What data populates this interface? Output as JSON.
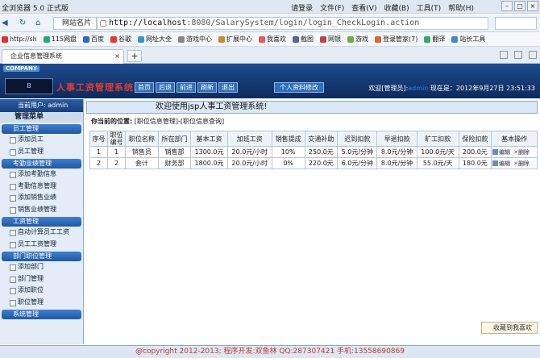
{
  "browser": {
    "title": "全浏览器 5.0 正式版",
    "menu": [
      "请登录",
      "文件(F)",
      "查看(V)",
      "收藏(B)",
      "工具(T)",
      "帮助(H)"
    ],
    "site_name": "网站名片",
    "url_host": "http://localhost",
    "url_path": ":8080/SalarySystem/login/login_CheckLogin.action",
    "favorites": [
      "http://sh",
      "115网盘",
      "百度",
      "谷歌",
      "网址大全",
      "游戏中心",
      "扩展中心",
      "我喜欢",
      "截图",
      "网银",
      "游戏",
      "登录管家(7)",
      "翻译",
      "站长工具"
    ],
    "tab_title": "企业信息管理系统",
    "new_tab": "+"
  },
  "app": {
    "company": "COMPANY",
    "logo": "B",
    "system_title": "人事工资管理系统",
    "menus": [
      "首页",
      "后退",
      "前进",
      "刷新",
      "退出"
    ],
    "profile": "个人资料修改",
    "welcome_label": "欢迎[管理员]:",
    "welcome_user": "admin",
    "now_label": "现在是：",
    "now_value": "2012年9月27日 23:51:33"
  },
  "sidebar": {
    "current_user": "当前用户: admin",
    "menu_title": "管理菜单",
    "groups": [
      {
        "label": "员工管理",
        "items": [
          "添加员工",
          "员工管理"
        ]
      },
      {
        "label": "考勤业绩管理",
        "items": [
          "添加考勤信息",
          "考勤信息管理",
          "添加销售业绩",
          "销售业绩管理"
        ]
      },
      {
        "label": "工资管理",
        "items": [
          "自动计算员工工资",
          "员工工资管理"
        ]
      },
      {
        "label": "部门职位管理",
        "items": [
          "添加部门",
          "部门管理",
          "添加职位",
          "职位管理"
        ]
      },
      {
        "label": "系统管理",
        "items": []
      }
    ]
  },
  "main": {
    "welcome": "欢迎使用jsp人事工资管理系统!",
    "location_label": "你当前的位置:",
    "location_path": "[职位信息管理]-[职位信息查询]",
    "table": {
      "headers": [
        "序号",
        "职位编号",
        "职位名称",
        "所在部门",
        "基本工资",
        "加班工资",
        "销售提成",
        "交通补助",
        "迟到扣款",
        "早退扣款",
        "旷工扣款",
        "保险扣款",
        "基本操作"
      ],
      "rows": [
        [
          "1",
          "1",
          "销售员",
          "销售部",
          "1300.0元",
          "20.0元/小时",
          "10%",
          "250.0元",
          "5.0元/分钟",
          "8.0元/分钟",
          "100.0元/天",
          "200.0元"
        ],
        [
          "2",
          "2",
          "会计",
          "财务部",
          "1800.0元",
          "20.0元/小时",
          "0%",
          "220.0元",
          "6.0元/分钟",
          "8.0元/分钟",
          "55.0元/天",
          "180.0元"
        ]
      ],
      "edit": "编辑",
      "delete": "删除"
    },
    "collect": "收藏到我喜欢"
  },
  "footer": "@copyright 2012-2013;  程序开发:双鱼林  QQ:287307421  手机:13558690869"
}
